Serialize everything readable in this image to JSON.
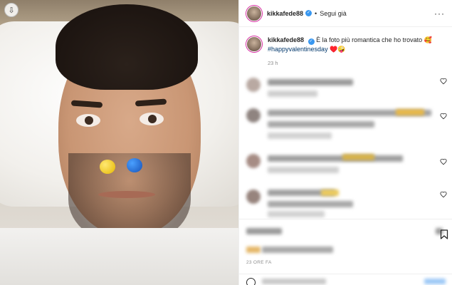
{
  "post": {
    "username": "kikkafede88",
    "follow_label": "Segui già",
    "more_label": "···",
    "caption_text": "È la foto più romantica che ho trovato 🥰",
    "caption_hashtag": "#happyvalentinesday",
    "caption_emoji": "♥️🤪",
    "caption_time": "23 h",
    "post_timestamp": "23 ORE FA"
  },
  "colors": {
    "link": "#00376b",
    "verified": "#3897f0",
    "muted": "#8e8e8e"
  },
  "icons": {
    "download": "download-icon",
    "verified": "verified-badge-icon",
    "heart": "heart-icon",
    "bookmark": "bookmark-icon",
    "emoji": "emoji-icon"
  }
}
